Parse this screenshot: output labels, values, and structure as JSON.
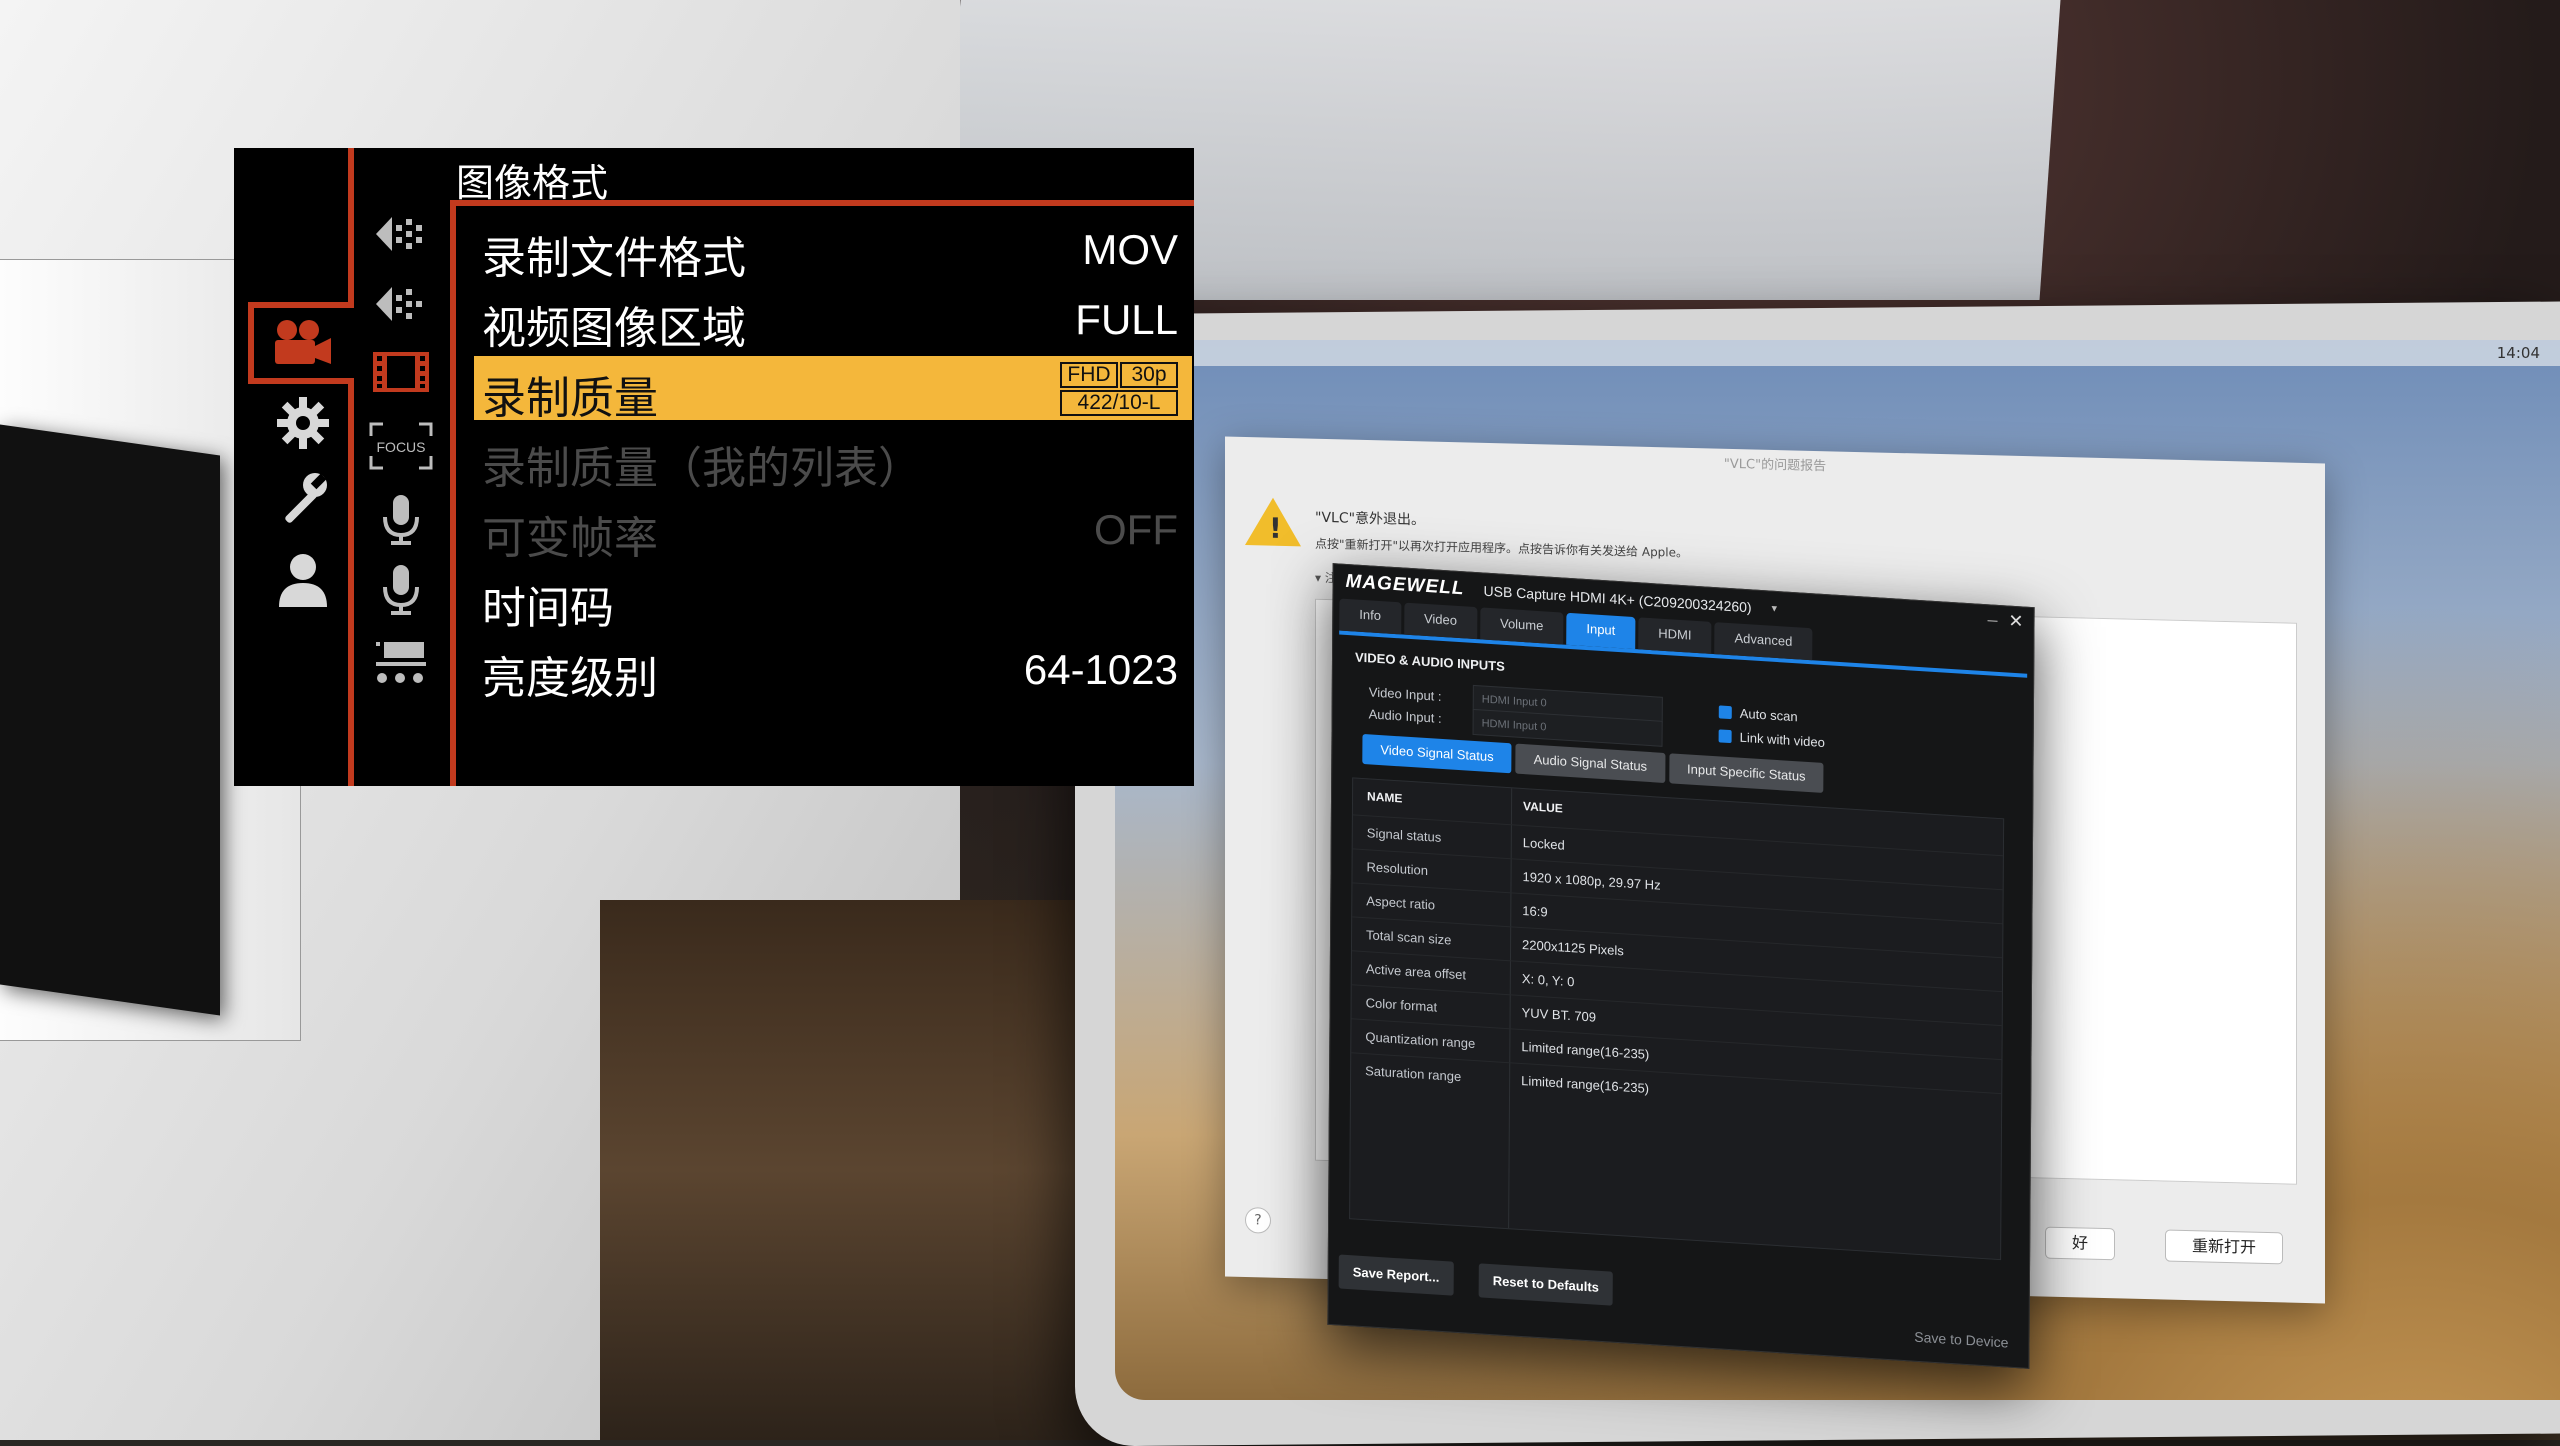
{
  "camera_menu": {
    "title": "图像格式",
    "main_icons": [
      "movie-camera-icon",
      "gear-icon",
      "wrench-icon",
      "person-icon"
    ],
    "sub_icons": [
      "exposure-mode-icon",
      "exposure-mode-2-icon",
      "film-strip-icon",
      "focus-icon",
      "microphone-icon",
      "microphone-2-icon",
      "custom-panel-icon"
    ],
    "items": [
      {
        "label": "录制文件格式",
        "value": "MOV",
        "state": "normal"
      },
      {
        "label": "视频图像区域",
        "value": "FULL",
        "state": "normal"
      },
      {
        "label": "录制质量",
        "value": "",
        "state": "selected",
        "badge": {
          "line1_left": "FHD",
          "line1_right": "30p",
          "line2": "422/10-L"
        }
      },
      {
        "label": "录制质量（我的列表）",
        "value": "",
        "state": "dim"
      },
      {
        "label": "可变帧率",
        "value": "OFF",
        "state": "dim"
      },
      {
        "label": "时间码",
        "value": "",
        "state": "normal"
      },
      {
        "label": "亮度级别",
        "value": "64-1023",
        "state": "normal"
      }
    ],
    "accent_color": "#c23a1e",
    "highlight_color": "#f4b73b"
  },
  "crash_dialog": {
    "title": "\"VLC\"的问题报告",
    "message": "\"VLC\"意外退出。",
    "detail": "点按\"重新打开\"以再次打开应用程序。点按告诉你有关发送给 Apple。",
    "note_label": "注释",
    "help_label": "?",
    "ok_button": "好",
    "reopen_button": "重新打开"
  },
  "magewell": {
    "logo": "MAGEWELL",
    "device_name": "USB Capture HDMI 4K+ (C209200324260)",
    "device_caret": "▾",
    "minimize": "–",
    "close": "✕",
    "tabs": [
      {
        "label": "Info",
        "active": false
      },
      {
        "label": "Video",
        "active": false
      },
      {
        "label": "Volume",
        "active": false
      },
      {
        "label": "Input",
        "active": true
      },
      {
        "label": "HDMI",
        "active": false
      },
      {
        "label": "Advanced",
        "active": false
      }
    ],
    "section_title": "VIDEO & AUDIO INPUTS",
    "video_input_label": "Video Input :",
    "video_input_value": "HDMI Input 0",
    "audio_input_label": "Audio Input :",
    "audio_input_value": "HDMI Input 0",
    "auto_scan": "Auto scan",
    "link_with_video": "Link with video",
    "subtabs": [
      {
        "label": "Video Signal Status",
        "active": true
      },
      {
        "label": "Audio Signal Status",
        "active": false
      },
      {
        "label": "Input Specific Status",
        "active": false
      }
    ],
    "table_headers": {
      "name": "NAME",
      "value": "VALUE"
    },
    "rows": [
      {
        "name": "Signal status",
        "value": "Locked"
      },
      {
        "name": "Resolution",
        "value": "1920 x 1080p, 29.97 Hz"
      },
      {
        "name": "Aspect ratio",
        "value": "16:9"
      },
      {
        "name": "Total scan size",
        "value": "2200x1125 Pixels"
      },
      {
        "name": "Active area offset",
        "value": "X: 0, Y: 0"
      },
      {
        "name": "Color format",
        "value": "YUV BT. 709"
      },
      {
        "name": "Quantization range",
        "value": "Limited range(16-235)"
      },
      {
        "name": "Saturation range",
        "value": "Limited range(16-235)"
      }
    ],
    "save_report": "Save Report...",
    "reset_defaults": "Reset to Defaults",
    "save_to_device": "Save to Device",
    "accent_color": "#1e84e8"
  },
  "mac_menubar": {
    "clock": "14:04"
  }
}
